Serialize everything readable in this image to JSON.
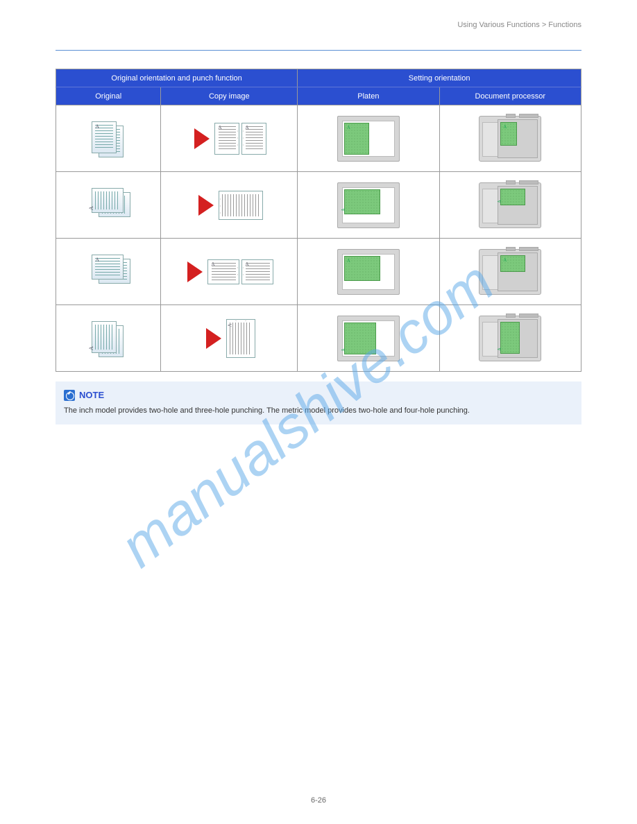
{
  "header": {
    "left": "",
    "right": "Using Various Functions > Functions"
  },
  "table": {
    "head1": "Original orientation and punch function",
    "head2": "Setting orientation",
    "subhead_original": "Original",
    "subhead_copy": "Copy image",
    "subhead_platen": "Platen",
    "subhead_docproc": "Document processor"
  },
  "note": {
    "title": "NOTE",
    "line1": "The inch model provides two-hole and three-hole punching. The metric model provides two-hole and four-hole punching.",
    "line2": ""
  },
  "page_number": "6-26"
}
